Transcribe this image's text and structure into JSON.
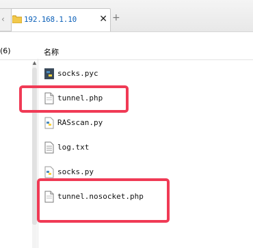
{
  "tab": {
    "title": "192.168.1.10",
    "close_label": "✕",
    "new_label": "+"
  },
  "header": {
    "left_count": "(6)",
    "name_column": "名称"
  },
  "files": [
    {
      "name": "socks.pyc",
      "icon": "python-compiled-icon"
    },
    {
      "name": "tunnel.php",
      "icon": "file-icon"
    },
    {
      "name": "RASscan.py",
      "icon": "python-icon"
    },
    {
      "name": "log.txt",
      "icon": "text-file-icon"
    },
    {
      "name": "socks.py",
      "icon": "python-icon"
    },
    {
      "name": "tunnel.nosocket.php",
      "icon": "file-icon"
    }
  ],
  "colors": {
    "highlight": "#f03a55",
    "tab_text": "#0a5fb8"
  }
}
